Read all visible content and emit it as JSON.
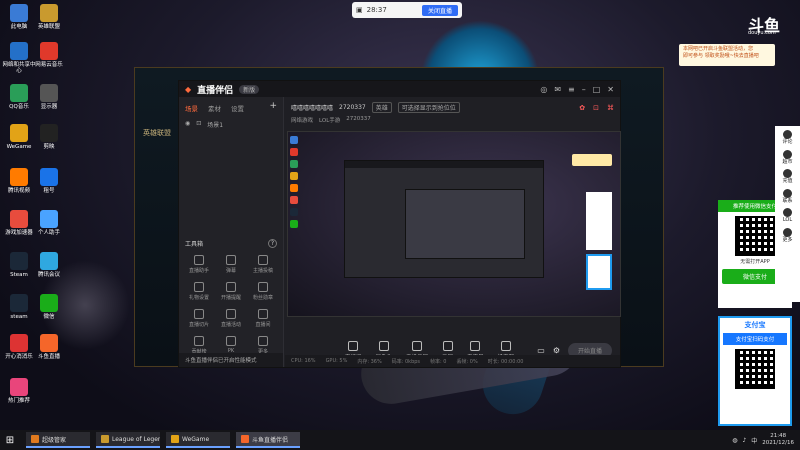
{
  "top_bar": {
    "record_time": "28:37",
    "close_button": "关闭直播"
  },
  "desktop_icons": [
    {
      "label": "此电脑",
      "color": "#3a7bd5"
    },
    {
      "label": "英雄联盟",
      "color": "#c99a2e"
    },
    {
      "label": "网络和共享中心",
      "color": "#2470c8"
    },
    {
      "label": "网易云音乐",
      "color": "#e0392b"
    },
    {
      "label": "QQ音乐",
      "color": "#2a9e58"
    },
    {
      "label": "显示器",
      "color": "#555"
    },
    {
      "label": "WeGame",
      "color": "#e2a317"
    },
    {
      "label": "剪映",
      "color": "#222"
    },
    {
      "label": "腾讯视频",
      "color": "#ff7b00"
    },
    {
      "label": "租号",
      "color": "#1a73e8"
    },
    {
      "label": "游戏加速器",
      "color": "#e84c3d"
    },
    {
      "label": "个人助手",
      "color": "#4aa3ff"
    },
    {
      "label": "Steam",
      "color": "#1b2838"
    },
    {
      "label": "腾讯会议",
      "color": "#2fa8e0"
    },
    {
      "label": "steam",
      "color": "#1b2838"
    },
    {
      "label": "微信",
      "color": "#1aad19"
    },
    {
      "label": "开心消消乐",
      "color": "#d33"
    },
    {
      "label": "斗鱼直播",
      "color": "#f5662a"
    },
    {
      "label": "热门推荐",
      "color": "#e9457b"
    }
  ],
  "app": {
    "logo_text": "直播伴侣",
    "version_pill": "新版",
    "left_tabs": [
      "场景",
      "素材",
      "设置"
    ],
    "scene_label": "场景1",
    "tools_title": "工具箱",
    "tools": [
      "直播助手",
      "弹幕",
      "主播投稿",
      "礼物设置",
      "开播提醒",
      "粉丝勋章",
      "直播切片",
      "直播活动",
      "直播间",
      "贡献榜",
      "PK",
      "更多"
    ],
    "footer_text": "斗鱼直播伴侣已开启性能模式",
    "room_title": "嘻嘻嘻嘻嘻嘻嘻",
    "room_id": "2720337",
    "room_tag": "英雄",
    "room_note": "可选择显示到抢位位",
    "sub_category": "网络游戏",
    "sub_game": "LOL手游",
    "sub_count": "2720337",
    "controls": [
      "直播间",
      "摄像头",
      "手机投屏",
      "录屏",
      "麦克风",
      "扬声器"
    ],
    "start_button": "开始直播",
    "status_items": [
      "CPU: 16%",
      "GPU: 5%",
      "内存: 36%",
      "码率: 0kbps",
      "帧率: 0",
      "丢帧: 0%",
      "时长: 00:00:00"
    ]
  },
  "lol_client": {
    "title": "英雄联盟"
  },
  "ads": {
    "douyu_logo": "斗鱼",
    "douyu_sub": "douyu.com",
    "note_line1": "本网吧已开启斗鱼联盟活动，您",
    "note_line2": "即可参与 领取奖励哦~快去直播吧",
    "wechat_header": "推荐使用微信支付",
    "wechat_sub": "无需打开APP",
    "wechat_brand": "微信支付",
    "alipay_brand": "支付宝",
    "alipay_header": "支付宝扫码支付"
  },
  "dock": [
    "评论",
    "超市",
    "充值",
    "联系",
    "LOL",
    "更多"
  ],
  "taskbar": {
    "items": [
      {
        "label": "超级管家",
        "color": "#e07a1f"
      },
      {
        "label": "League of Legends",
        "color": "#c99a2e"
      },
      {
        "label": "WeGame",
        "color": "#e2a317"
      },
      {
        "label": "斗鱼直播伴侣",
        "color": "#f5662a"
      }
    ],
    "time": "21:48",
    "date": "2021/12/16",
    "lang": "中"
  }
}
